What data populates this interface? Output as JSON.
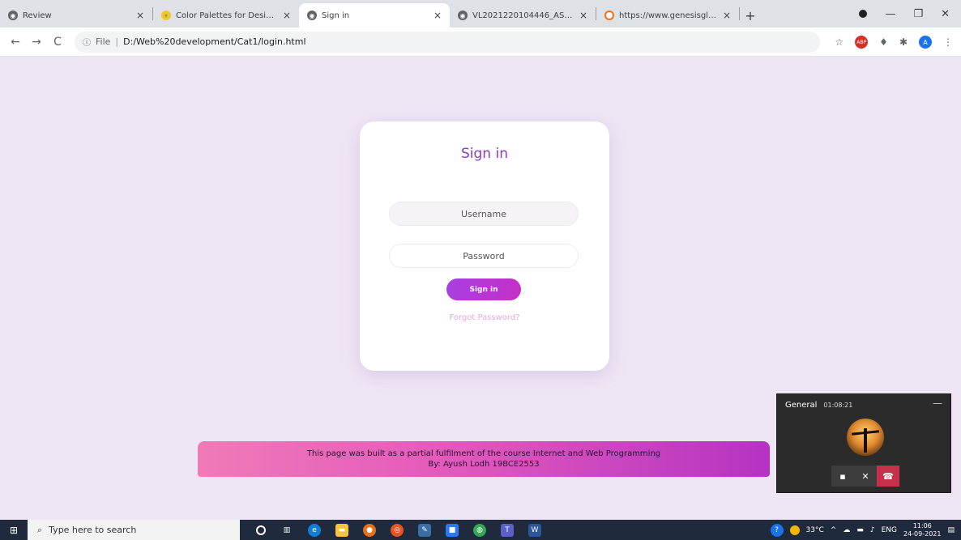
{
  "browser": {
    "tabs": [
      {
        "title": "Review",
        "active": false,
        "favicon": "globe-icon"
      },
      {
        "title": "Color Palettes for Designers and",
        "active": false,
        "favicon": "palette-icon"
      },
      {
        "title": "Sign in",
        "active": true,
        "favicon": "globe-icon"
      },
      {
        "title": "VL2021220104446_AST02.pdf",
        "active": false,
        "favicon": "globe-icon"
      },
      {
        "title": "https://www.genesisglobalschool",
        "active": false,
        "favicon": "circle-icon"
      }
    ],
    "close_glyph": "×",
    "new_tab_glyph": "+",
    "window_controls": {
      "minimize": "—",
      "restore": "❐",
      "close": "✕"
    },
    "nav": {
      "back": "←",
      "forward": "→",
      "reload": "C"
    },
    "address": {
      "scheme_label": "File",
      "url": "D:/Web%20development/Cat1/login.html"
    },
    "profile_initial": "A"
  },
  "login": {
    "title": "Sign in",
    "username_placeholder": "Username",
    "password_placeholder": "Password",
    "button_label": "Sign in",
    "forgot_link": "Forgot Password?"
  },
  "footer": {
    "line1": "This page was built as a partial fulfilment of the course Internet and Web Programming",
    "line2": "By: Ayush Lodh 19BCE2553"
  },
  "call": {
    "channel": "General",
    "duration": "01:08:21",
    "minimize": "—"
  },
  "taskbar": {
    "search_placeholder": "Type here to search",
    "weather": "33°C",
    "language": "ENG",
    "time": "11:06",
    "date": "24-09-2021"
  },
  "colors": {
    "page_bg": "#efe6f5",
    "title": "#8e3bb0",
    "button_gradient_start": "#a83fe0",
    "button_gradient_end": "#c530c8",
    "banner_start": "#f07ab8",
    "banner_end": "#b533c2",
    "hangup": "#c4314b"
  }
}
